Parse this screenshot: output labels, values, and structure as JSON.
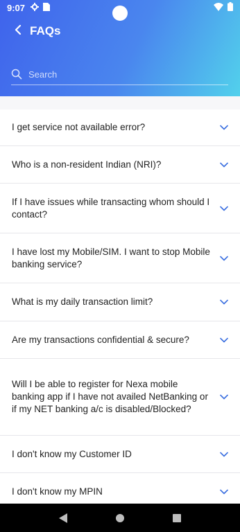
{
  "status_bar": {
    "time": "9:07",
    "icons_left": [
      "settings-icon",
      "sim-card-icon"
    ],
    "icons_right": [
      "wifi-icon",
      "battery-icon"
    ]
  },
  "header": {
    "title": "FAQs",
    "back_icon": "chevron-left-icon",
    "search_placeholder": "Search"
  },
  "faqs": [
    {
      "question": "I get service not available error?"
    },
    {
      "question": "Who is a non-resident Indian (NRI)?"
    },
    {
      "question": "If I have issues while transacting whom should I contact?"
    },
    {
      "question": "I have lost my Mobile/SIM. I want to stop Mobile banking service?"
    },
    {
      "question": "What is my daily transaction limit?"
    },
    {
      "question": "Are my transactions confidential & secure?"
    },
    {
      "question": "Will I be able to register for Nexa mobile banking app if I have not availed NetBanking or if my NET banking a/c is disabled/Blocked?"
    },
    {
      "question": "I don't know my Customer ID"
    },
    {
      "question": "I don't know my MPIN"
    }
  ],
  "colors": {
    "gradient_start": "#3f63ec",
    "gradient_end": "#52d1ec",
    "chevron": "#3b6fe0"
  },
  "navbar": {
    "buttons": [
      "back-triangle-icon",
      "home-circle-icon",
      "recents-square-icon"
    ]
  }
}
